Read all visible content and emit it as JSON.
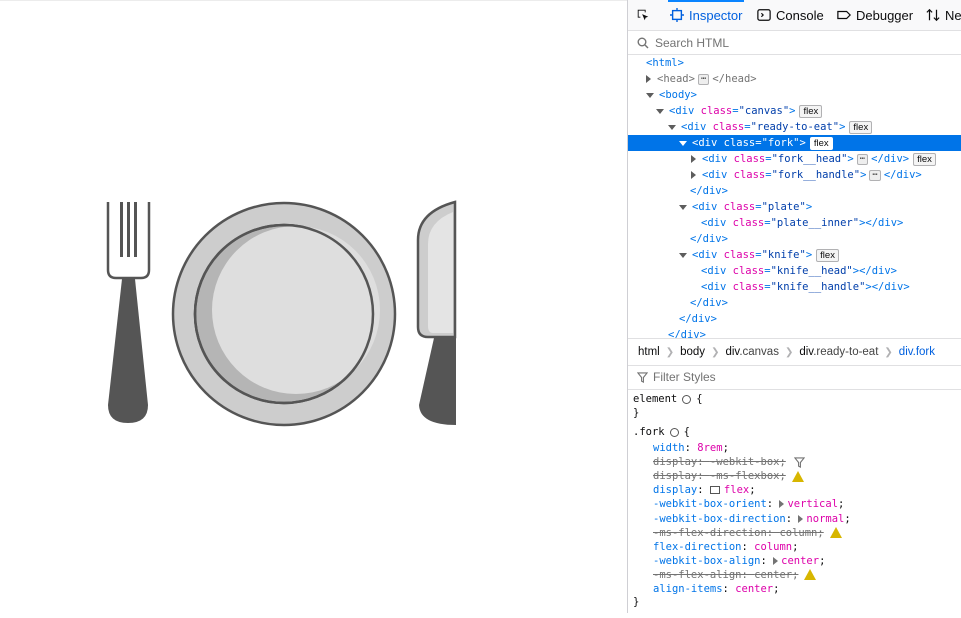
{
  "toolbar": {
    "picker_icon": "element-picker-icon",
    "tabs": [
      {
        "label": "Inspector",
        "icon": "inspector-icon"
      },
      {
        "label": "Console",
        "icon": "console-icon"
      },
      {
        "label": "Debugger",
        "icon": "debugger-icon"
      },
      {
        "label": "Ne",
        "icon": "network-icon"
      }
    ]
  },
  "search": {
    "placeholder": "Search HTML"
  },
  "tree": {
    "html_open": "<html>",
    "head_open": "<head>",
    "head_close": "</head>",
    "body_open": "<body>",
    "div": "div",
    "class_attr": "class",
    "flex_badge": "flex",
    "canvas": "\"canvas\"",
    "ready": "\"ready-to-eat\"",
    "fork": "\"fork\"",
    "fork_head": "\"fork__head\"",
    "fork_handle": "\"fork__handle\"",
    "plate": "\"plate\"",
    "plate_inner": "\"plate__inner\"",
    "knife": "\"knife\"",
    "knife_head": "\"knife__head\"",
    "knife_handle": "\"knife__handle\"",
    "div_close": "</div>",
    "ellipsis": "⋯"
  },
  "breadcrumbs": {
    "html": "html",
    "body": "body",
    "canvas_tag": "div",
    "canvas_cls": ".canvas",
    "ready_tag": "div",
    "ready_cls": ".ready-to-eat",
    "current": "div.fork"
  },
  "filter": {
    "placeholder": "Filter Styles"
  },
  "rules": {
    "element_selector": "element",
    "open_brace": "{",
    "close_brace": "}",
    "fork_selector": ".fork",
    "decls": [
      {
        "name": "width",
        "value": "8rem",
        "struck": false
      },
      {
        "name": "display",
        "value": "-webkit-box",
        "struck": true
      },
      {
        "name": "display",
        "value": "-ms-flexbox",
        "struck": true
      },
      {
        "name": "display",
        "value": "flex",
        "struck": false
      },
      {
        "name": "-webkit-box-orient",
        "value": "vertical",
        "struck": false
      },
      {
        "name": "-webkit-box-direction",
        "value": "normal",
        "struck": false
      },
      {
        "name": "-ms-flex-direction",
        "value": "column",
        "struck": true
      },
      {
        "name": "flex-direction",
        "value": "column",
        "struck": false
      },
      {
        "name": "-webkit-box-align",
        "value": "center",
        "struck": false
      },
      {
        "name": "-ms-flex-align",
        "value": "center",
        "struck": true
      },
      {
        "name": "align-items",
        "value": "center",
        "struck": false
      }
    ]
  },
  "illustration": {
    "colors": {
      "dark": "#555555",
      "light": "#cdcdcd",
      "mid": "#b5b5b5",
      "inner": "#dedede"
    },
    "items": [
      "fork",
      "plate",
      "knife"
    ]
  }
}
